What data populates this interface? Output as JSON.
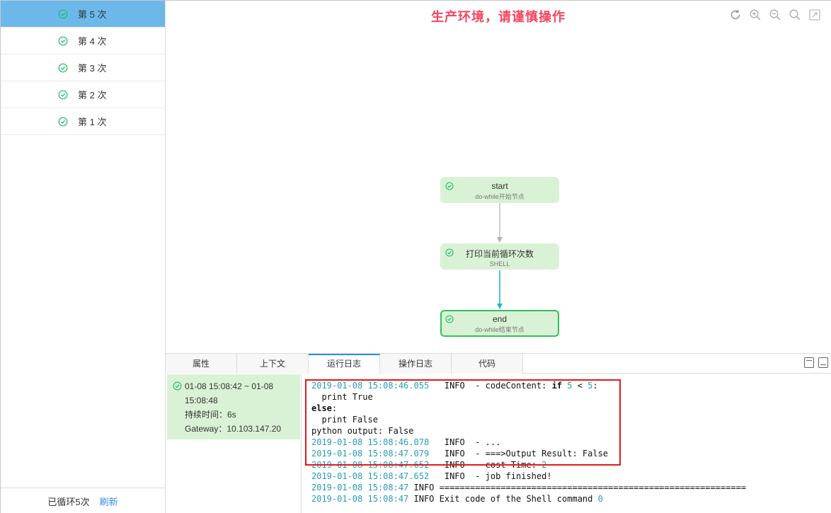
{
  "sidebar": {
    "items": [
      {
        "label": "第 5 次",
        "active": true
      },
      {
        "label": "第 4 次",
        "active": false
      },
      {
        "label": "第 3 次",
        "active": false
      },
      {
        "label": "第 2 次",
        "active": false
      },
      {
        "label": "第 1 次",
        "active": false
      }
    ],
    "footer_text": "已循环5次",
    "refresh_label": "刷新"
  },
  "canvas": {
    "warning": "生产环境，请谨慎操作",
    "toolbar_icons": [
      "refresh-icon",
      "zoom-in-icon",
      "zoom-out-icon",
      "search-icon",
      "fullscreen-icon"
    ],
    "nodes": [
      {
        "title": "start",
        "subtitle": "do-while开始节点"
      },
      {
        "title": "打印当前循环次数",
        "subtitle": "SHELL"
      },
      {
        "title": "end",
        "subtitle": "do-while结束节点"
      }
    ]
  },
  "panel": {
    "tabs": [
      "属性",
      "上下文",
      "运行日志",
      "操作日志",
      "代码"
    ],
    "active_tab": "运行日志",
    "run_info": {
      "time_range": "01-08 15:08:42 ~ 01-08",
      "time_end": "15:08:48",
      "duration": "持续时间：6s",
      "gateway": "Gateway：10.103.147.20"
    },
    "log": {
      "l1_ts_a": "2019-01-08 15",
      "l1_ts_b": ":08:46.055",
      "l1_msg": "   INFO  - codeContent: ",
      "l1_if": "if",
      "l1_sp": " ",
      "l1_n1": "5",
      "l1_lt": " < ",
      "l1_n2": "5",
      "l1_colon": ":",
      "l2": "  print True",
      "l3_else": "else",
      "l3_colon": ":",
      "l4": "  print False",
      "l5": "python output: False",
      "l6_ts_a": "2019-01-08 15",
      "l6_ts_b": ":08:46.078",
      "l6_msg": "   INFO  - ...",
      "l7_ts_a": "2019-01-08 15",
      "l7_ts_b": ":08:47.079",
      "l7_msg": "   INFO  - ===>Output Result: False",
      "l8_ts_a": "2019-01-08 15",
      "l8_ts_b": ":08:47.652",
      "l8_msg": "   INFO  - cost Time: ",
      "l8_n": "2",
      "l9_ts_a": "2019-01-08 15",
      "l9_ts_b": ":08:47.652",
      "l9_msg": "   INFO  - job finished!",
      "l10_ts_a": "2019-01-08 15",
      "l10_ts_b": ":08:47",
      "l10_msg": " INFO ============================================================",
      "l11_ts_a": "2019-01-08 15",
      "l11_ts_b": ":08:47",
      "l11_msg": " INFO Exit code of the Shell command ",
      "l11_n": "0"
    }
  },
  "colors": {
    "active_item": "#6cb8ea",
    "warning": "#f5465e",
    "node_fill": "#d9f2d5",
    "selected_border": "#34c05d",
    "highlight": "#e01a1a",
    "timestamp": "#2a9bb7"
  }
}
